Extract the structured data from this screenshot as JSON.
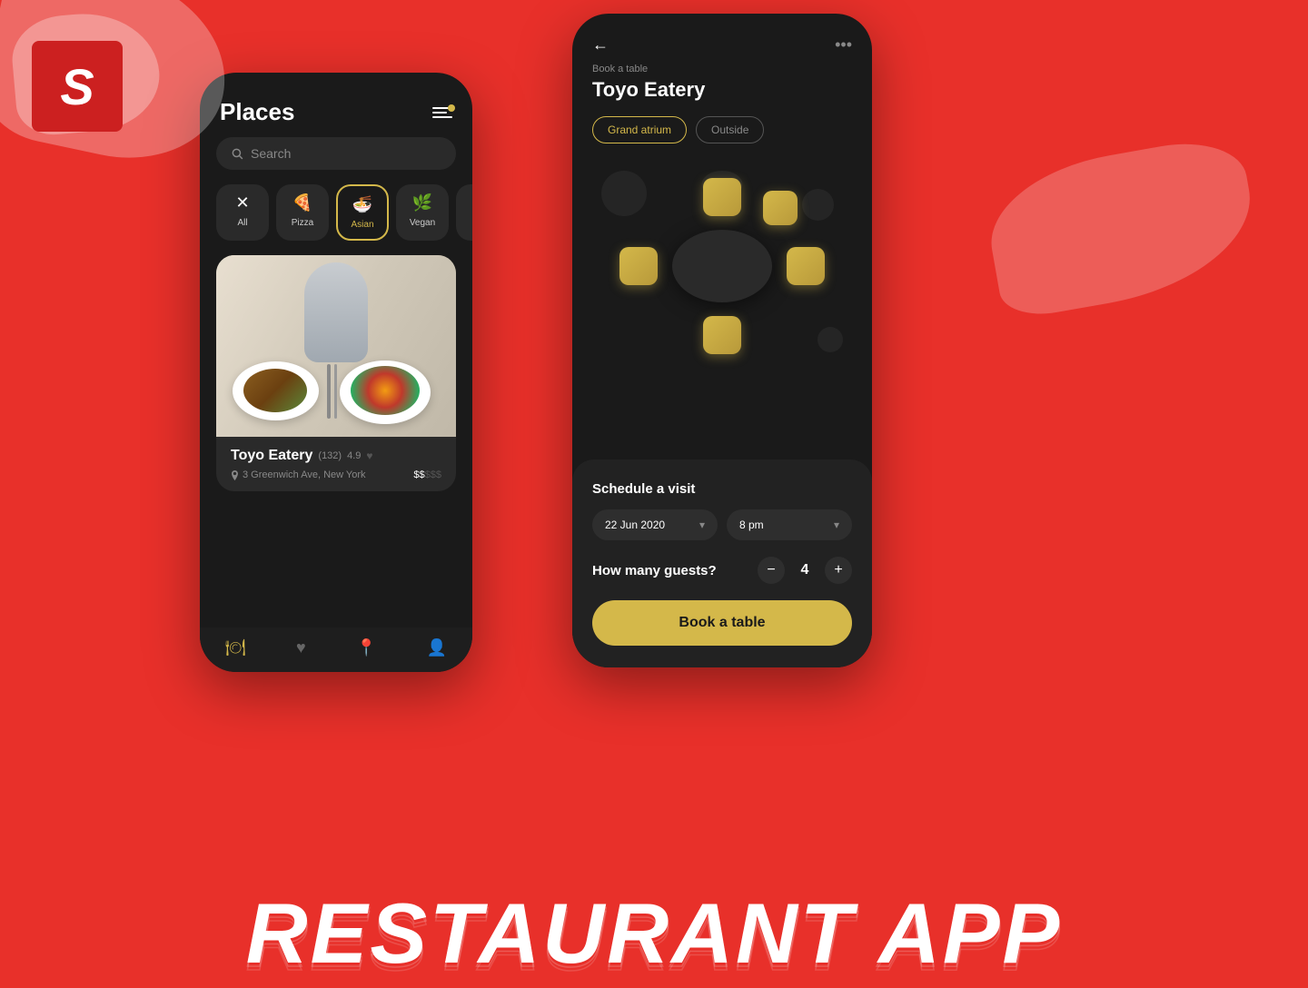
{
  "app": {
    "background_color": "#e8302a"
  },
  "logo": {
    "icon": "S"
  },
  "phone1": {
    "title": "Places",
    "filter_icon": "≡",
    "search": {
      "placeholder": "Search"
    },
    "categories": [
      {
        "id": "all",
        "icon": "✕",
        "label": "All",
        "active": false
      },
      {
        "id": "pizza",
        "icon": "🍕",
        "label": "Pizza",
        "active": false
      },
      {
        "id": "asian",
        "icon": "🍜",
        "label": "Asian",
        "active": true
      },
      {
        "id": "vegan",
        "icon": "🌿",
        "label": "Vegan",
        "active": false
      }
    ],
    "restaurant": {
      "name": "Toyo Eatery",
      "reviews": "(132)",
      "rating": "4.9",
      "address": "3 Greenwich Ave, New York",
      "price": "$$$"
    },
    "nav": {
      "items": [
        {
          "icon": "🍽",
          "active": true
        },
        {
          "icon": "♥",
          "active": false
        },
        {
          "icon": "📍",
          "active": false
        },
        {
          "icon": "👤",
          "active": false
        }
      ]
    }
  },
  "phone2": {
    "subtitle": "Book a table",
    "title": "Toyo Eatery",
    "location_tabs": [
      {
        "label": "Grand atrium",
        "active": true
      },
      {
        "label": "Outside",
        "active": false
      }
    ],
    "table": {
      "seats": 5
    },
    "schedule": {
      "section_title": "Schedule a visit",
      "date": "22 Jun 2020",
      "time": "8 pm"
    },
    "guests": {
      "label": "How many guests?",
      "count": 4,
      "minus": "−",
      "plus": "+"
    },
    "book_button": "Book a table"
  },
  "footer": {
    "text": "RESTAURANT APP"
  }
}
